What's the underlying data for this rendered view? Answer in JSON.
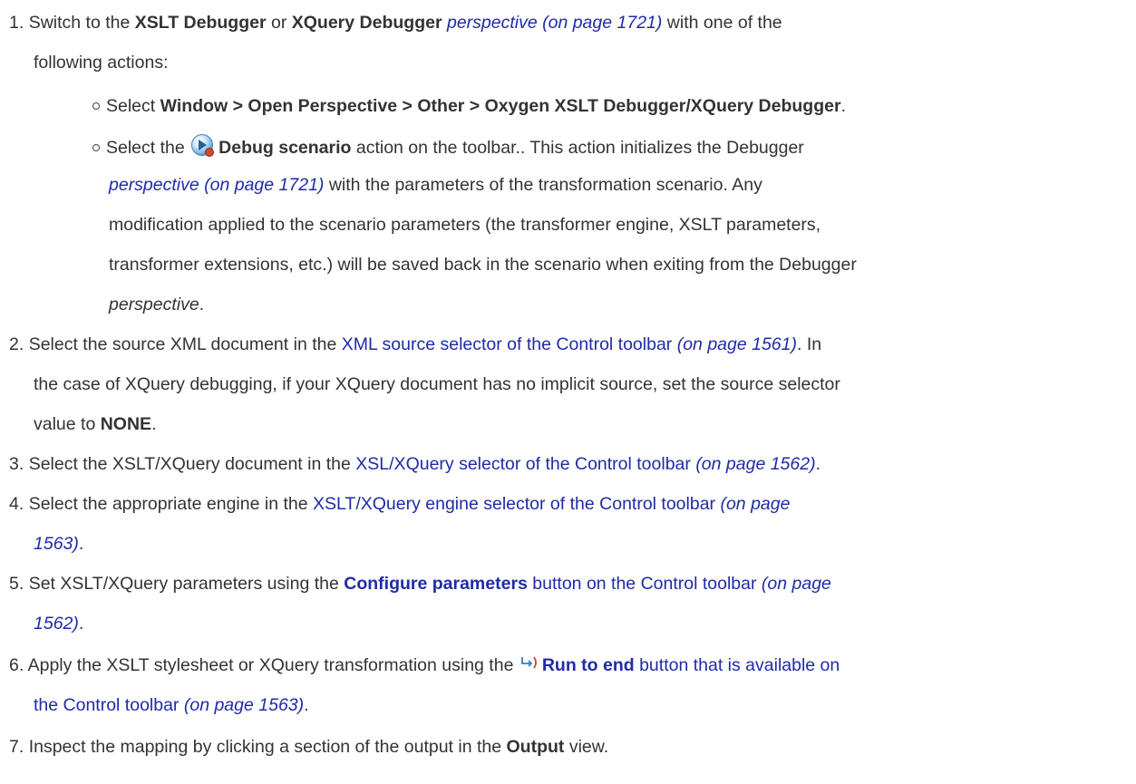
{
  "steps": {
    "s1": {
      "num": "1.",
      "pre": "Switch to the ",
      "xslt_debugger": "XSLT Debugger",
      "or": " or ",
      "xquery_debugger": "XQuery Debugger",
      "perspective_link": "perspective (on page 1721)",
      "post": " with one of the",
      "line2": "following actions:",
      "sub1": {
        "pre": "Select ",
        "menu_path": "Window > Open Perspective > Other  > Oxygen XSLT Debugger/XQuery Debugger",
        "post": "."
      },
      "sub2": {
        "pre": "Select the ",
        "action": "Debug scenario",
        "line1_post": " action on the toolbar.. This action initializes the Debugger",
        "perspective_link": "perspective (on page 1721)",
        "line2_post": " with the parameters of the transformation scenario. Any",
        "line3": "modification applied to the scenario parameters (the transformer engine, XSLT parameters,",
        "line4": "transformer extensions, etc.) will be saved back in the scenario when exiting from the Debugger",
        "line5_em": "perspective",
        "line5_post": "."
      }
    },
    "s2": {
      "num": "2.",
      "pre": "Select the source XML document in the ",
      "link": "XML source selector of the Control toolbar",
      "ref": "(on page 1561)",
      "post": ". In",
      "line2": "the case of XQuery debugging, if your XQuery document has no implicit source, set the source selector",
      "line3_pre": "value to ",
      "line3_bold": "NONE",
      "line3_post": "."
    },
    "s3": {
      "num": "3.",
      "pre": "Select the XSLT/XQuery document in the ",
      "link": "XSL/XQuery selector of the Control toolbar",
      "ref": "(on page 1562)",
      "post": "."
    },
    "s4": {
      "num": "4.",
      "pre": "Select the appropriate engine in the ",
      "link": "XSLT/XQuery engine selector of the Control toolbar",
      "ref1": "(on page",
      "ref2": "1563)",
      "post": "."
    },
    "s5": {
      "num": "5.",
      "pre": "Set XSLT/XQuery parameters using the ",
      "link_bold": "Configure parameters",
      "link": " button on the Control toolbar",
      "ref1": "(on page",
      "ref2": "1562)",
      "post": "."
    },
    "s6": {
      "num": "6.",
      "pre": "Apply the XSLT stylesheet or XQuery transformation using the ",
      "link_bold": "Run to end",
      "link": " button that is available on",
      "line2_link": "the Control toolbar",
      "ref": "(on page 1563)",
      "post": "."
    },
    "s7": {
      "num": "7.",
      "pre": "Inspect the mapping by clicking a section of the output in the ",
      "bold": "Output",
      "post": " view."
    }
  },
  "icons": {
    "debug_scenario": "debug-scenario-icon",
    "run_to_end": "run-to-end-icon"
  },
  "colors": {
    "text": "#333333",
    "link": "#1f2ba8"
  }
}
